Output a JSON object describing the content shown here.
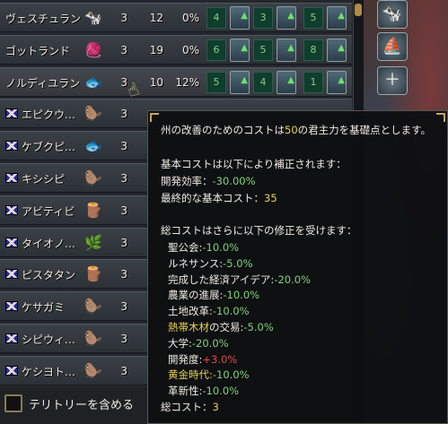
{
  "provinces": [
    {
      "name": "ヴェスチュラン",
      "flag": false,
      "good_icon": "livestock-icon",
      "dev": "3",
      "points": "12",
      "pct": "0%",
      "cells": [
        "4",
        "3",
        "5"
      ]
    },
    {
      "name": "ゴットランド",
      "flag": false,
      "good_icon": "cloth-icon",
      "dev": "3",
      "points": "19",
      "pct": "0%",
      "cells": [
        "6",
        "5",
        "8"
      ]
    },
    {
      "name": "ノルディユラン",
      "flag": false,
      "good_icon": "fish-icon",
      "dev": "3",
      "points": "10",
      "pct": "12%",
      "cells": [
        "5",
        "4",
        "1"
      ]
    },
    {
      "name": "エピクウ…",
      "flag": true,
      "good_icon": "fur-icon",
      "dev": "3"
    },
    {
      "name": "ケブクピ…",
      "flag": true,
      "good_icon": "fish-icon",
      "dev": "3"
    },
    {
      "name": "キシシピ",
      "flag": true,
      "good_icon": "fur-icon",
      "dev": "3"
    },
    {
      "name": "アビティビ",
      "flag": true,
      "good_icon": "lumber-icon",
      "dev": "3"
    },
    {
      "name": "タイオノ…",
      "flag": true,
      "good_icon": "naval-supplies-icon",
      "dev": "3"
    },
    {
      "name": "ピスタタン",
      "flag": true,
      "good_icon": "lumber-icon",
      "dev": "3"
    },
    {
      "name": "ケサガミ",
      "flag": true,
      "good_icon": "fur-icon",
      "dev": "3"
    },
    {
      "name": "シピウィ…",
      "flag": true,
      "good_icon": "fur-icon",
      "dev": "3"
    },
    {
      "name": "ケシヨト…",
      "flag": true,
      "good_icon": "fur-icon",
      "dev": "3"
    }
  ],
  "territory_checkbox": {
    "label": "テリトリーを含める",
    "checked": false
  },
  "tooltip": {
    "line1_a": "州の改善のためのコストは",
    "line1_num": "50",
    "line1_b": "の君主力を基礎点とします。",
    "base_header": "基本コストは以下により補正されます：",
    "dev_eff_label": "開発効率：",
    "dev_eff_value": "-30.00%",
    "final_base_label": "最終的な基本コスト：",
    "final_base_value": "35",
    "total_header": "総コストはさらに以下の修正を受けます：",
    "modifiers": [
      {
        "label": "聖公会:",
        "value": "-10.0%",
        "label_color": "normal",
        "value_color": "green"
      },
      {
        "label": "ルネサンス:",
        "value": "-5.0%",
        "label_color": "normal",
        "value_color": "green"
      },
      {
        "label": "完成した経済アイデア:",
        "value": "-20.0%",
        "label_color": "normal",
        "value_color": "green"
      },
      {
        "label": "農業の進展:",
        "value": "-10.0%",
        "label_color": "normal",
        "value_color": "green"
      },
      {
        "label": "土地改革:",
        "value": "-10.0%",
        "label_color": "normal",
        "value_color": "green"
      },
      {
        "label": "熱帯木材",
        "label_suffix": "の交易:",
        "value": "-5.0%",
        "label_color": "yellow",
        "value_color": "green"
      },
      {
        "label": "大学:",
        "value": "-20.0%",
        "label_color": "normal",
        "value_color": "green"
      },
      {
        "label": "開発度:",
        "value": "+3.0%",
        "label_color": "normal",
        "value_color": "red"
      },
      {
        "label": "黄金時代:",
        "value": "-10.0%",
        "label_color": "yellow",
        "value_color": "green"
      },
      {
        "label": "革新性:",
        "value": "-10.0%",
        "label_color": "normal",
        "value_color": "green"
      }
    ],
    "total_label": "総コスト：",
    "total_value": "3"
  },
  "side_buttons": [
    "cow-icon",
    "ship-icon",
    "add-building-icon"
  ],
  "colors": {
    "green": "#7fd47a",
    "yellow": "#e8d256",
    "red": "#e04a3c",
    "accent": "#c8a45d"
  }
}
